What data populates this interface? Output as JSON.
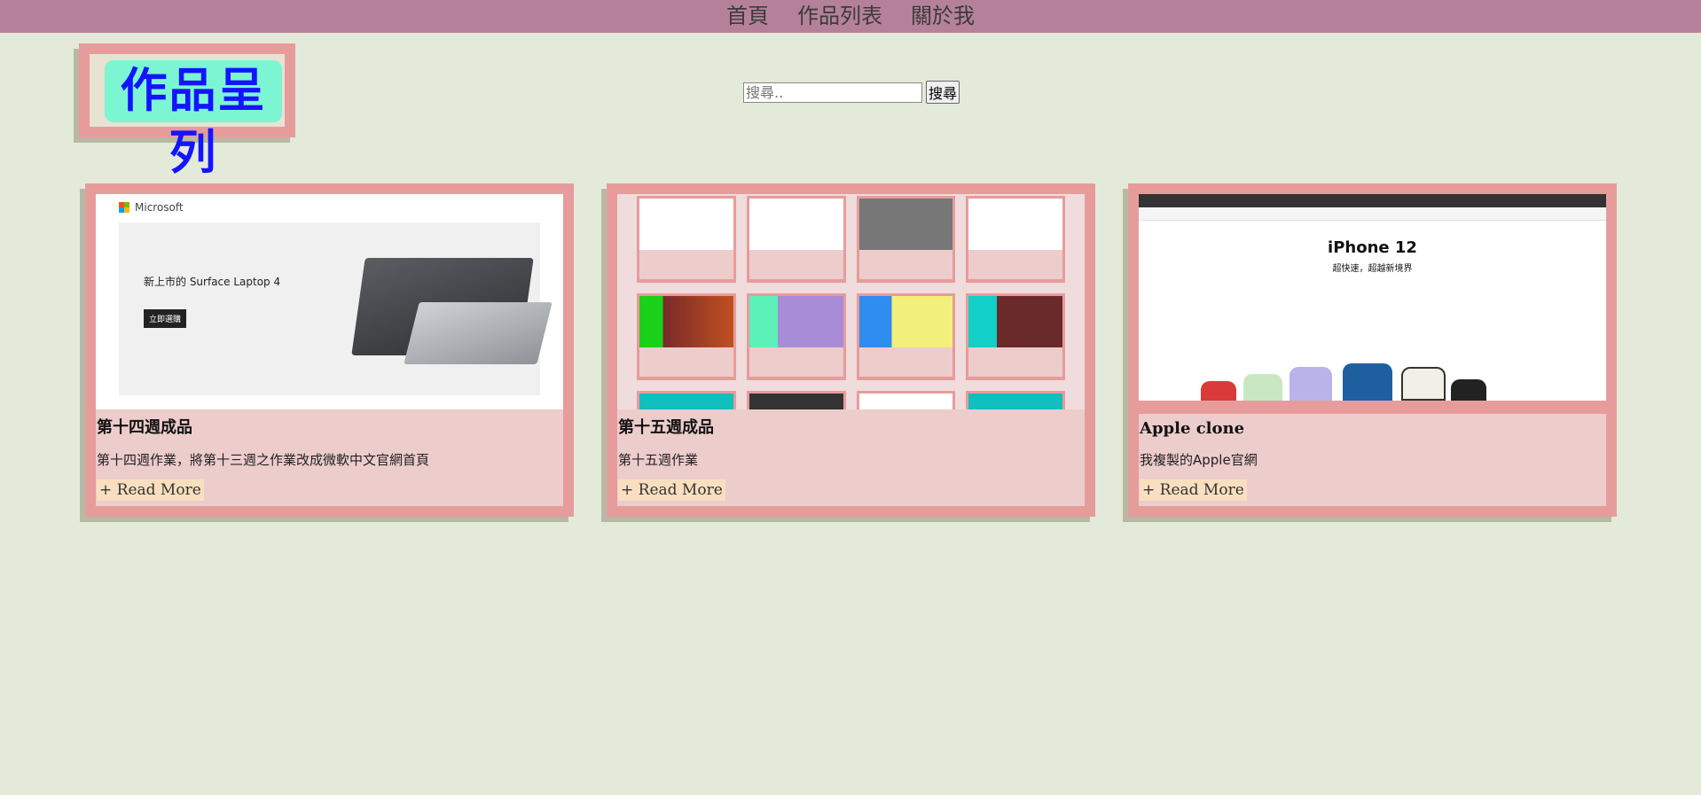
{
  "nav": {
    "items": [
      "首頁",
      "作品列表",
      "關於我"
    ]
  },
  "logo": {
    "text": "作品呈列"
  },
  "search": {
    "placeholder": "搜尋..",
    "button_label": "搜尋"
  },
  "cards": [
    {
      "title": "第十四週成品",
      "desc": "第十四週作業，將第十三週之作業改成微軟中文官網首頁",
      "more": "+ Read More",
      "thumb": {
        "brand": "Microsoft",
        "headline": "新上市的 Surface Laptop 4",
        "cta": "立即選購"
      }
    },
    {
      "title": "第十五週成品",
      "desc": "第十五週作業",
      "more": "+ Read More"
    },
    {
      "title": "Apple clone",
      "desc": "我複製的Apple官網",
      "more": "+ Read More",
      "thumb": {
        "headline": "iPhone 12",
        "sub": "超快速，超越新境界"
      }
    }
  ],
  "colors": {
    "page_bg": "#e4ead9",
    "nav_bg": "#b5819a",
    "card_frame": "#e79c9c",
    "card_body": "#edcccc",
    "logo_bg": "#7bf5d2",
    "logo_text": "#1414ff",
    "read_more_bg": "#f9dfbf"
  }
}
